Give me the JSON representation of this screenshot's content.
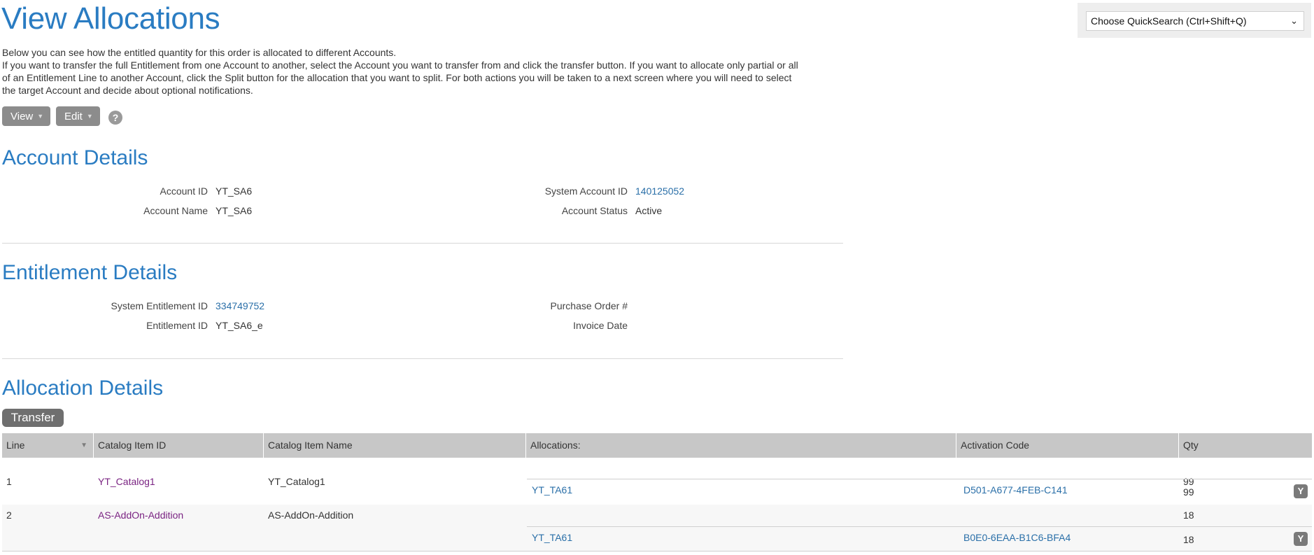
{
  "page": {
    "title": "View Allocations",
    "quicksearch_label": "Choose QuickSearch (Ctrl+Shift+Q)",
    "intro_line1": "Below you can see how the entitled quantity for this order is allocated to different Accounts.",
    "intro_line2": "If you want to transfer the full Entitlement from one Account to another, select the Account you want to transfer from and click the transfer button. If you want to allocate only partial or all of an Entitlement Line to another Account, click the Split button for the allocation that you want to split. For both actions you will be taken to a next screen where you will need to select the target Account and decide about optional notifications."
  },
  "toolbar": {
    "view_label": "View",
    "edit_label": "Edit",
    "help_glyph": "?",
    "arrow_glyph": "▼",
    "chevron_glyph": "⌄"
  },
  "account": {
    "section_title": "Account Details",
    "account_id_label": "Account ID",
    "account_id": "YT_SA6",
    "account_name_label": "Account Name",
    "account_name": "YT_SA6",
    "system_account_id_label": "System Account ID",
    "system_account_id": "140125052",
    "account_status_label": "Account Status",
    "account_status": "Active"
  },
  "entitlement": {
    "section_title": "Entitlement Details",
    "system_entitlement_id_label": "System Entitlement ID",
    "system_entitlement_id": "334749752",
    "entitlement_id_label": "Entitlement ID",
    "entitlement_id": "YT_SA6_e",
    "purchase_order_label": "Purchase Order #",
    "purchase_order": "",
    "invoice_date_label": "Invoice Date",
    "invoice_date": ""
  },
  "allocation": {
    "section_title": "Allocation Details",
    "transfer_label": "Transfer",
    "split_icon_glyph": "Y",
    "columns": [
      "Line",
      "Catalog Item ID",
      "Catalog Item Name",
      "Allocations:",
      "Activation Code",
      "Qty"
    ],
    "rows": [
      {
        "line": "1",
        "catalog_item_id": "YT_Catalog1",
        "catalog_item_name": "YT_Catalog1",
        "qty": "99",
        "alloc_account": "YT_TA61",
        "activation_code": "D501-A677-4FEB-C141",
        "alloc_qty": "99"
      },
      {
        "line": "2",
        "catalog_item_id": "AS-AddOn-Addition",
        "catalog_item_name": "AS-AddOn-Addition",
        "qty": "18",
        "alloc_account": "YT_TA61",
        "activation_code": "B0E0-6EAA-B1C6-BFA4",
        "alloc_qty": "18"
      }
    ]
  },
  "colors": {
    "accent": "#2a7cc2",
    "link": "#2a6fa8",
    "catalog_link": "#7a2382",
    "header_bg": "#c7c7c7",
    "button_bg": "#8c8c8c"
  }
}
